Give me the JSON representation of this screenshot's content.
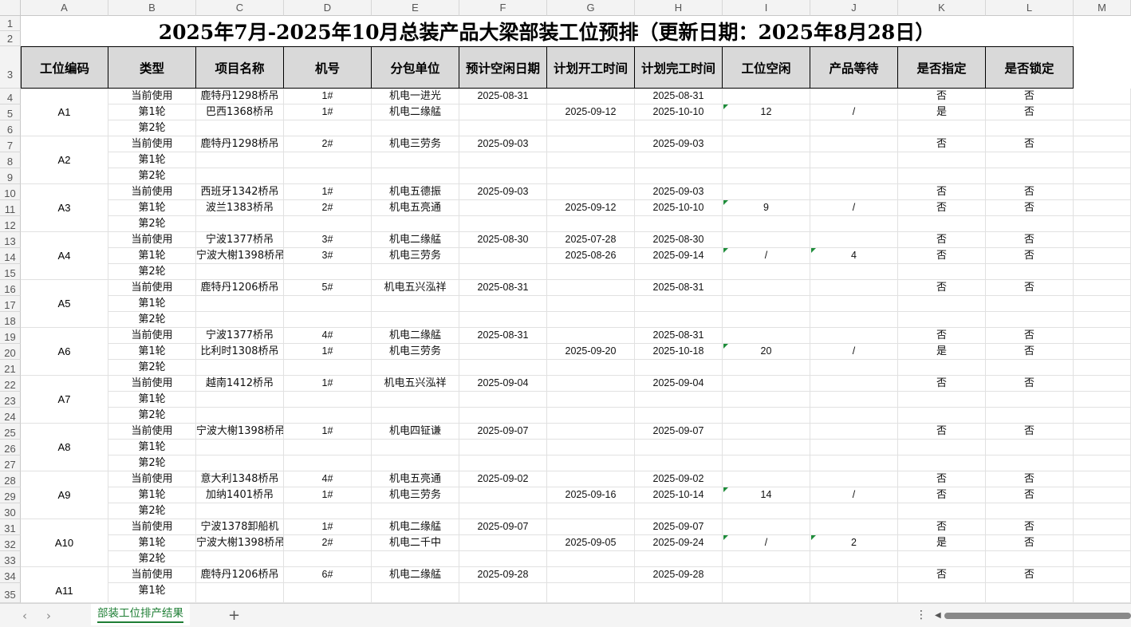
{
  "columns": [
    "A",
    "B",
    "C",
    "D",
    "E",
    "F",
    "G",
    "H",
    "I",
    "J",
    "K",
    "L",
    "M"
  ],
  "title": "2025年7月-2025年10月总装产品大梁部装工位预排（更新日期：2025年8月28日）",
  "headers": [
    "工位编码",
    "类型",
    "项目名称",
    "机号",
    "分包单位",
    "预计空闲日期",
    "计划开工时间",
    "计划完工时间",
    "工位空闲",
    "产品等待",
    "是否指定",
    "是否锁定"
  ],
  "row_numbers": [
    "1",
    "2",
    "3",
    "4",
    "5",
    "6",
    "7",
    "8",
    "9",
    "10",
    "11",
    "12",
    "13",
    "14",
    "15",
    "16",
    "17",
    "18",
    "19",
    "20",
    "21",
    "22",
    "23",
    "24",
    "25",
    "26",
    "27",
    "28",
    "29",
    "30",
    "31",
    "32",
    "33",
    "34",
    "35"
  ],
  "stations": [
    "A1",
    "A2",
    "A3",
    "A4",
    "A5",
    "A6",
    "A7",
    "A8",
    "A9",
    "A10",
    "A11"
  ],
  "rows": [
    [
      "当前使用",
      "鹿特丹1298桥吊",
      "1#",
      "机电一进光",
      "2025-08-31",
      "",
      "2025-08-31",
      "",
      "",
      "否",
      "否"
    ],
    [
      "第1轮",
      "巴西1368桥吊",
      "1#",
      "机电二缘艋",
      "",
      "2025-09-12",
      "2025-10-10",
      "12",
      "/",
      "是",
      "否"
    ],
    [
      "第2轮",
      "",
      "",
      "",
      "",
      "",
      "",
      "",
      "",
      "",
      ""
    ],
    [
      "当前使用",
      "鹿特丹1298桥吊",
      "2#",
      "机电三劳务",
      "2025-09-03",
      "",
      "2025-09-03",
      "",
      "",
      "否",
      "否"
    ],
    [
      "第1轮",
      "",
      "",
      "",
      "",
      "",
      "",
      "",
      "",
      "",
      ""
    ],
    [
      "第2轮",
      "",
      "",
      "",
      "",
      "",
      "",
      "",
      "",
      "",
      ""
    ],
    [
      "当前使用",
      "西班牙1342桥吊",
      "1#",
      "机电五德振",
      "2025-09-03",
      "",
      "2025-09-03",
      "",
      "",
      "否",
      "否"
    ],
    [
      "第1轮",
      "波兰1383桥吊",
      "2#",
      "机电五亮通",
      "",
      "2025-09-12",
      "2025-10-10",
      "9",
      "/",
      "否",
      "否"
    ],
    [
      "第2轮",
      "",
      "",
      "",
      "",
      "",
      "",
      "",
      "",
      "",
      ""
    ],
    [
      "当前使用",
      "宁波1377桥吊",
      "3#",
      "机电二缘艋",
      "2025-08-30",
      "2025-07-28",
      "2025-08-30",
      "",
      "",
      "否",
      "否"
    ],
    [
      "第1轮",
      "宁波大榭1398桥吊",
      "3#",
      "机电三劳务",
      "",
      "2025-08-26",
      "2025-09-14",
      "/",
      "4",
      "否",
      "否"
    ],
    [
      "第2轮",
      "",
      "",
      "",
      "",
      "",
      "",
      "",
      "",
      "",
      ""
    ],
    [
      "当前使用",
      "鹿特丹1206桥吊",
      "5#",
      "机电五兴泓祥",
      "2025-08-31",
      "",
      "2025-08-31",
      "",
      "",
      "否",
      "否"
    ],
    [
      "第1轮",
      "",
      "",
      "",
      "",
      "",
      "",
      "",
      "",
      "",
      ""
    ],
    [
      "第2轮",
      "",
      "",
      "",
      "",
      "",
      "",
      "",
      "",
      "",
      ""
    ],
    [
      "当前使用",
      "宁波1377桥吊",
      "4#",
      "机电二缘艋",
      "2025-08-31",
      "",
      "2025-08-31",
      "",
      "",
      "否",
      "否"
    ],
    [
      "第1轮",
      "比利时1308桥吊",
      "1#",
      "机电三劳务",
      "",
      "2025-09-20",
      "2025-10-18",
      "20",
      "/",
      "是",
      "否"
    ],
    [
      "第2轮",
      "",
      "",
      "",
      "",
      "",
      "",
      "",
      "",
      "",
      ""
    ],
    [
      "当前使用",
      "越南1412桥吊",
      "1#",
      "机电五兴泓祥",
      "2025-09-04",
      "",
      "2025-09-04",
      "",
      "",
      "否",
      "否"
    ],
    [
      "第1轮",
      "",
      "",
      "",
      "",
      "",
      "",
      "",
      "",
      "",
      ""
    ],
    [
      "第2轮",
      "",
      "",
      "",
      "",
      "",
      "",
      "",
      "",
      "",
      ""
    ],
    [
      "当前使用",
      "宁波大榭1398桥吊",
      "1#",
      "机电四钲谦",
      "2025-09-07",
      "",
      "2025-09-07",
      "",
      "",
      "否",
      "否"
    ],
    [
      "第1轮",
      "",
      "",
      "",
      "",
      "",
      "",
      "",
      "",
      "",
      ""
    ],
    [
      "第2轮",
      "",
      "",
      "",
      "",
      "",
      "",
      "",
      "",
      "",
      ""
    ],
    [
      "当前使用",
      "意大利1348桥吊",
      "4#",
      "机电五亮通",
      "2025-09-02",
      "",
      "2025-09-02",
      "",
      "",
      "否",
      "否"
    ],
    [
      "第1轮",
      "加纳1401桥吊",
      "1#",
      "机电三劳务",
      "",
      "2025-09-16",
      "2025-10-14",
      "14",
      "/",
      "否",
      "否"
    ],
    [
      "第2轮",
      "",
      "",
      "",
      "",
      "",
      "",
      "",
      "",
      "",
      ""
    ],
    [
      "当前使用",
      "宁波1378卸船机",
      "1#",
      "机电二缘艋",
      "2025-09-07",
      "",
      "2025-09-07",
      "",
      "",
      "否",
      "否"
    ],
    [
      "第1轮",
      "宁波大榭1398桥吊",
      "2#",
      "机电二千中",
      "",
      "2025-09-05",
      "2025-09-24",
      "/",
      "2",
      "是",
      "否"
    ],
    [
      "第2轮",
      "",
      "",
      "",
      "",
      "",
      "",
      "",
      "",
      "",
      ""
    ],
    [
      "当前使用",
      "鹿特丹1206桥吊",
      "6#",
      "机电二缘艋",
      "2025-09-28",
      "",
      "2025-09-28",
      "",
      "",
      "否",
      "否"
    ],
    [
      "第1轮",
      "",
      "",
      "",
      "",
      "",
      "",
      "",
      "",
      "",
      ""
    ]
  ],
  "sheet_tab": "部装工位排产结果",
  "accent": "#1e7e34"
}
